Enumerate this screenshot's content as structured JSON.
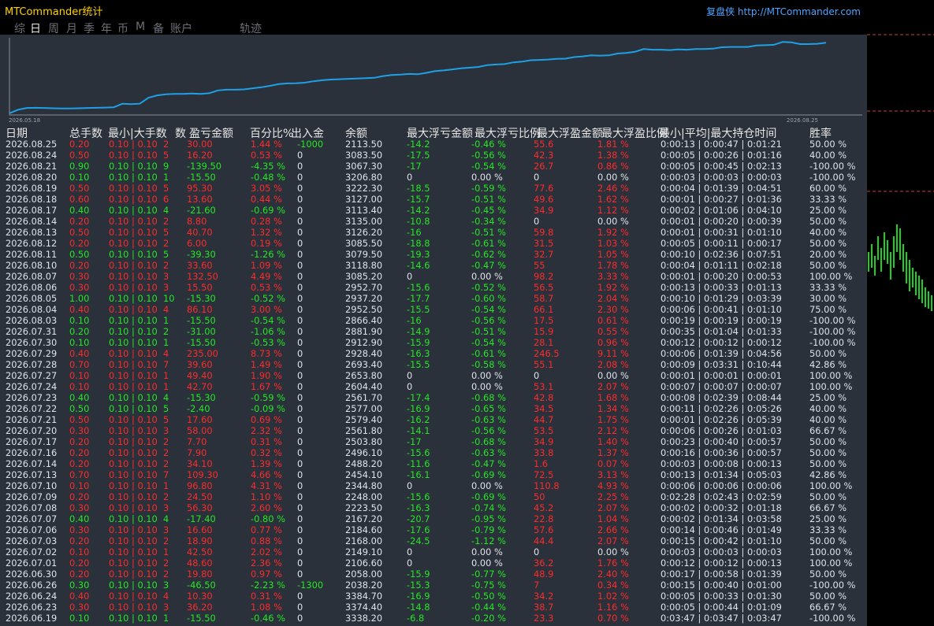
{
  "window": {
    "title": "MTCommander统计",
    "brand": "复盘侠 http://MTCommander.com"
  },
  "tabs": [
    {
      "label": "综"
    },
    {
      "label": "日"
    },
    {
      "label": "周"
    },
    {
      "label": "月"
    },
    {
      "label": "季"
    },
    {
      "label": "年"
    },
    {
      "label": "币"
    },
    {
      "label": "M"
    },
    {
      "label": "备"
    },
    {
      "label": "账户"
    },
    {
      "label": "轨迹"
    }
  ],
  "active_tab": "日",
  "chart": {
    "start_label": "2026.05.18",
    "end_label": "2026.08.25"
  },
  "chart_data": {
    "type": "line",
    "xlabel": "",
    "ylabel": "",
    "x_range": [
      "2026.05.18",
      "2026.08.25"
    ],
    "y_range": [
      1000,
      3200
    ],
    "series": [
      {
        "values": [
          1050,
          1150,
          1200,
          1205,
          1200,
          1190,
          1185,
          1185,
          1190,
          1200,
          1205,
          1210,
          1220,
          1320,
          1310,
          1320,
          1490,
          1560,
          1590,
          1600,
          1600,
          1610,
          1600,
          1620,
          1700,
          1720,
          1720,
          1730,
          1760,
          1790,
          1830,
          1880,
          1900,
          1905,
          1920,
          1960,
          1990,
          2010,
          2020,
          2030,
          2040,
          2050,
          2060,
          2110,
          2140,
          2150,
          2170,
          2160,
          2200,
          2250,
          2270,
          2300,
          2330,
          2350,
          2370,
          2420,
          2440,
          2450,
          2500,
          2520,
          2560,
          2570,
          2580,
          2600,
          2605,
          2650,
          2670,
          2700,
          2690,
          2700,
          2750,
          2770,
          2800,
          2880,
          2860,
          2860,
          2850,
          2870,
          2860,
          2880,
          2880,
          2890,
          2930,
          2940,
          2940,
          2940,
          2980,
          2990,
          3000,
          3080,
          3070,
          3020,
          3020,
          3030,
          3060
        ]
      }
    ],
    "grid": false,
    "legend": "none"
  },
  "columns": [
    "日期",
    "总手数",
    "最小|大手数",
    "数",
    "盈亏金额",
    "百分比%",
    "出入金",
    "余额",
    "最大浮亏金额",
    "最大浮亏比例",
    "最大浮盈金额",
    "最大浮盈比例",
    "最小|平均|最大持仓时间",
    "胜率"
  ],
  "rows": [
    [
      "2026.08.25",
      "0.20",
      "0.10 | 0.10",
      "2",
      "30.00",
      "1.44 %",
      "-1000",
      "2113.50",
      "-14.2",
      "-0.46 %",
      "55.6",
      "1.81 %",
      "0:00:13 | 0:00:47 | 0:01:21",
      "50.00 %"
    ],
    [
      "2026.08.24",
      "0.50",
      "0.10 | 0.10",
      "5",
      "16.20",
      "0.53 %",
      "0",
      "3083.50",
      "-17.5",
      "-0.56 %",
      "42.3",
      "1.38 %",
      "0:00:05 | 0:00:26 | 0:01:16",
      "40.00 %"
    ],
    [
      "2026.08.21",
      "0.90",
      "0.10 | 0.10",
      "9",
      "-139.50",
      "-4.35 %",
      "0",
      "3067.30",
      "-17",
      "-0.54 %",
      "26.7",
      "0.86 %",
      "0:00:05 | 0:00:45 | 0:02:13",
      "-100.00 %"
    ],
    [
      "2026.08.20",
      "0.10",
      "0.10 | 0.10",
      "1",
      "-15.50",
      "-0.48 %",
      "0",
      "3206.80",
      "0",
      "0.00 %",
      "0",
      "0.00 %",
      "0:00:03 | 0:00:03 | 0:00:03",
      "-100.00 %"
    ],
    [
      "2026.08.19",
      "0.50",
      "0.10 | 0.10",
      "5",
      "95.30",
      "3.05 %",
      "0",
      "3222.30",
      "-18.5",
      "-0.59 %",
      "77.6",
      "2.46 %",
      "0:00:04 | 0:01:39 | 0:04:51",
      "60.00 %"
    ],
    [
      "2026.08.18",
      "0.60",
      "0.10 | 0.10",
      "6",
      "13.60",
      "0.44 %",
      "0",
      "3127.00",
      "-15.7",
      "-0.51 %",
      "49.6",
      "1.62 %",
      "0:00:01 | 0:00:27 | 0:01:36",
      "33.33 %"
    ],
    [
      "2026.08.17",
      "0.40",
      "0.10 | 0.10",
      "4",
      "-21.60",
      "-0.69 %",
      "0",
      "3113.40",
      "-14.2",
      "-0.45 %",
      "34.9",
      "1.12 %",
      "0:00:02 | 0:01:06 | 0:04:10",
      "25.00 %"
    ],
    [
      "2026.08.14",
      "0.20",
      "0.10 | 0.10",
      "2",
      "8.80",
      "0.28 %",
      "0",
      "3135.00",
      "-10.8",
      "-0.34 %",
      "0",
      "0.00 %",
      "0:00:01 | 0:00:20 | 0:00:39",
      "50.00 %"
    ],
    [
      "2026.08.13",
      "0.50",
      "0.10 | 0.10",
      "5",
      "40.70",
      "1.32 %",
      "0",
      "3126.20",
      "-16",
      "-0.51 %",
      "59.8",
      "1.92 %",
      "0:00:01 | 0:00:31 | 0:01:10",
      "40.00 %"
    ],
    [
      "2026.08.12",
      "0.20",
      "0.10 | 0.10",
      "2",
      "6.00",
      "0.19 %",
      "0",
      "3085.50",
      "-18.8",
      "-0.61 %",
      "31.5",
      "1.03 %",
      "0:00:05 | 0:00:11 | 0:00:17",
      "50.00 %"
    ],
    [
      "2026.08.11",
      "0.50",
      "0.10 | 0.10",
      "5",
      "-39.30",
      "-1.26 %",
      "0",
      "3079.50",
      "-19.3",
      "-0.62 %",
      "32.7",
      "1.05 %",
      "0:00:10 | 0:02:36 | 0:07:51",
      "20.00 %"
    ],
    [
      "2026.08.10",
      "0.20",
      "0.10 | 0.10",
      "2",
      "33.60",
      "1.09 %",
      "0",
      "3118.80",
      "-14.6",
      "-0.47 %",
      "55",
      "1.78 %",
      "0:00:04 | 0:01:11 | 0:02:18",
      "50.00 %"
    ],
    [
      "2026.08.07",
      "0.30",
      "0.10 | 0.10",
      "3",
      "132.50",
      "4.49 %",
      "0",
      "3085.20",
      "0",
      "0.00 %",
      "98.2",
      "3.33 %",
      "0:00:01 | 0:00:20 | 0:00:53",
      "100.00 %"
    ],
    [
      "2026.08.06",
      "0.30",
      "0.10 | 0.10",
      "3",
      "15.50",
      "0.53 %",
      "0",
      "2952.70",
      "-15.6",
      "-0.52 %",
      "56.5",
      "1.92 %",
      "0:00:13 | 0:00:33 | 0:01:13",
      "33.33 %"
    ],
    [
      "2026.08.05",
      "1.00",
      "0.10 | 0.10",
      "10",
      "-15.30",
      "-0.52 %",
      "0",
      "2937.20",
      "-17.7",
      "-0.60 %",
      "58.7",
      "2.04 %",
      "0:00:10 | 0:01:29 | 0:03:39",
      "30.00 %"
    ],
    [
      "2026.08.04",
      "0.40",
      "0.10 | 0.10",
      "4",
      "86.10",
      "3.00 %",
      "0",
      "2952.50",
      "-15.5",
      "-0.54 %",
      "66.1",
      "2.30 %",
      "0:00:06 | 0:00:41 | 0:01:10",
      "75.00 %"
    ],
    [
      "2026.08.03",
      "0.10",
      "0.10 | 0.10",
      "1",
      "-15.50",
      "-0.54 %",
      "0",
      "2866.40",
      "-16",
      "-0.56 %",
      "17.5",
      "0.61 %",
      "0:00:19 | 0:00:19 | 0:00:19",
      "-100.00 %"
    ],
    [
      "2026.07.31",
      "0.20",
      "0.10 | 0.10",
      "2",
      "-31.00",
      "-1.06 %",
      "0",
      "2881.90",
      "-14.9",
      "-0.51 %",
      "15.9",
      "0.55 %",
      "0:00:35 | 0:01:04 | 0:01:33",
      "-100.00 %"
    ],
    [
      "2026.07.30",
      "0.10",
      "0.10 | 0.10",
      "1",
      "-15.50",
      "-0.53 %",
      "0",
      "2912.90",
      "-15.9",
      "-0.54 %",
      "28.1",
      "0.96 %",
      "0:00:12 | 0:00:12 | 0:00:12",
      "-100.00 %"
    ],
    [
      "2026.07.29",
      "0.40",
      "0.10 | 0.10",
      "4",
      "235.00",
      "8.73 %",
      "0",
      "2928.40",
      "-16.3",
      "-0.61 %",
      "246.5",
      "9.11 %",
      "0:00:06 | 0:01:39 | 0:04:56",
      "50.00 %"
    ],
    [
      "2026.07.28",
      "0.70",
      "0.10 | 0.10",
      "7",
      "39.60",
      "1.49 %",
      "0",
      "2693.40",
      "-15.5",
      "-0.58 %",
      "55.1",
      "2.08 %",
      "0:00:09 | 0:03:31 | 0:10:44",
      "42.86 %"
    ],
    [
      "2026.07.27",
      "0.10",
      "0.10 | 0.10",
      "1",
      "49.40",
      "1.90 %",
      "0",
      "2653.80",
      "0",
      "0.00 %",
      "0",
      "0.00 %",
      "0:00:01 | 0:00:01 | 0:00:01",
      "100.00 %"
    ],
    [
      "2026.07.24",
      "0.10",
      "0.10 | 0.10",
      "1",
      "42.70",
      "1.67 %",
      "0",
      "2604.40",
      "0",
      "0.00 %",
      "53.1",
      "2.07 %",
      "0:00:07 | 0:00:07 | 0:00:07",
      "100.00 %"
    ],
    [
      "2026.07.23",
      "0.40",
      "0.10 | 0.10",
      "4",
      "-15.30",
      "-0.59 %",
      "0",
      "2561.70",
      "-17.4",
      "-0.68 %",
      "42.8",
      "1.68 %",
      "0:00:08 | 0:02:39 | 0:08:44",
      "25.00 %"
    ],
    [
      "2026.07.22",
      "0.50",
      "0.10 | 0.10",
      "5",
      "-2.40",
      "-0.09 %",
      "0",
      "2577.00",
      "-16.9",
      "-0.65 %",
      "34.5",
      "1.34 %",
      "0:00:11 | 0:02:26 | 0:05:26",
      "40.00 %"
    ],
    [
      "2026.07.21",
      "0.50",
      "0.10 | 0.10",
      "5",
      "17.60",
      "0.69 %",
      "0",
      "2579.40",
      "-16.2",
      "-0.63 %",
      "44.7",
      "1.75 %",
      "0:00:01 | 0:02:26 | 0:05:39",
      "40.00 %"
    ],
    [
      "2026.07.20",
      "0.30",
      "0.10 | 0.10",
      "3",
      "58.00",
      "2.32 %",
      "0",
      "2561.80",
      "-14.1",
      "-0.56 %",
      "53.5",
      "2.12 %",
      "0:00:06 | 0:00:26 | 0:01:03",
      "66.67 %"
    ],
    [
      "2026.07.17",
      "0.20",
      "0.10 | 0.10",
      "2",
      "7.70",
      "0.31 %",
      "0",
      "2503.80",
      "-17",
      "-0.68 %",
      "34.9",
      "1.40 %",
      "0:00:23 | 0:00:40 | 0:00:57",
      "50.00 %"
    ],
    [
      "2026.07.16",
      "0.20",
      "0.10 | 0.10",
      "2",
      "7.90",
      "0.32 %",
      "0",
      "2496.10",
      "-15.6",
      "-0.63 %",
      "33.8",
      "1.37 %",
      "0:00:16 | 0:00:36 | 0:00:57",
      "50.00 %"
    ],
    [
      "2026.07.14",
      "0.20",
      "0.10 | 0.10",
      "2",
      "34.10",
      "1.39 %",
      "0",
      "2488.20",
      "-11.6",
      "-0.47 %",
      "1.6",
      "0.07 %",
      "0:00:03 | 0:00:08 | 0:00:13",
      "50.00 %"
    ],
    [
      "2026.07.13",
      "0.70",
      "0.10 | 0.10",
      "7",
      "109.30",
      "4.66 %",
      "0",
      "2454.10",
      "-16.1",
      "-0.69 %",
      "72.5",
      "3.13 %",
      "0:00:13 | 0:01:34 | 0:05:03",
      "42.86 %"
    ],
    [
      "2026.07.10",
      "0.10",
      "0.10 | 0.10",
      "1",
      "96.80",
      "4.31 %",
      "0",
      "2344.80",
      "0",
      "0.00 %",
      "110.8",
      "4.93 %",
      "0:00:06 | 0:00:06 | 0:00:06",
      "100.00 %"
    ],
    [
      "2026.07.09",
      "0.20",
      "0.10 | 0.10",
      "2",
      "24.50",
      "1.10 %",
      "0",
      "2248.00",
      "-15.6",
      "-0.69 %",
      "50",
      "2.25 %",
      "0:02:28 | 0:02:43 | 0:02:59",
      "50.00 %"
    ],
    [
      "2026.07.08",
      "0.30",
      "0.10 | 0.10",
      "3",
      "56.30",
      "2.60 %",
      "0",
      "2223.50",
      "-16.3",
      "-0.74 %",
      "45.2",
      "2.07 %",
      "0:00:02 | 0:00:32 | 0:01:18",
      "66.67 %"
    ],
    [
      "2026.07.07",
      "0.40",
      "0.10 | 0.10",
      "4",
      "-17.40",
      "-0.80 %",
      "0",
      "2167.20",
      "-20.7",
      "-0.95 %",
      "22.8",
      "1.04 %",
      "0:00:02 | 0:01:34 | 0:03:58",
      "25.00 %"
    ],
    [
      "2026.07.06",
      "0.30",
      "0.10 | 0.10",
      "3",
      "16.60",
      "0.77 %",
      "0",
      "2184.60",
      "-17.6",
      "-0.79 %",
      "57.6",
      "2.66 %",
      "0:00:14 | 0:00:46 | 0:01:49",
      "33.33 %"
    ],
    [
      "2026.07.03",
      "0.20",
      "0.10 | 0.10",
      "2",
      "18.90",
      "0.88 %",
      "0",
      "2168.00",
      "-24.5",
      "-1.12 %",
      "44.4",
      "2.07 %",
      "0:00:15 | 0:00:42 | 0:01:10",
      "50.00 %"
    ],
    [
      "2026.07.02",
      "0.10",
      "0.10 | 0.10",
      "1",
      "42.50",
      "2.02 %",
      "0",
      "2149.10",
      "0",
      "0.00 %",
      "0",
      "0.00 %",
      "0:00:03 | 0:00:03 | 0:00:03",
      "100.00 %"
    ],
    [
      "2026.07.01",
      "0.20",
      "0.10 | 0.10",
      "2",
      "48.60",
      "2.36 %",
      "0",
      "2106.60",
      "0",
      "0.00 %",
      "36.2",
      "1.76 %",
      "0:00:12 | 0:00:12 | 0:00:13",
      "100.00 %"
    ],
    [
      "2026.06.30",
      "0.20",
      "0.10 | 0.10",
      "2",
      "19.80",
      "0.97 %",
      "0",
      "2058.00",
      "-15.9",
      "-0.77 %",
      "48.9",
      "2.40 %",
      "0:00:17 | 0:00:58 | 0:01:39",
      "50.00 %"
    ],
    [
      "2026.06.26",
      "0.30",
      "0.10 | 0.10",
      "3",
      "-46.50",
      "-2.23 %",
      "-1300",
      "2038.20",
      "-15.3",
      "-0.75 %",
      "7",
      "0.34 %",
      "0:00:15 | 0:00:40 | 0:01:00",
      "-100.00 %"
    ],
    [
      "2026.06.24",
      "0.40",
      "0.10 | 0.10",
      "4",
      "10.30",
      "0.31 %",
      "0",
      "3384.70",
      "-16.9",
      "-0.50 %",
      "34.2",
      "1.02 %",
      "0:00:05 | 0:00:33 | 0:01:30",
      "50.00 %"
    ],
    [
      "2026.06.23",
      "0.30",
      "0.10 | 0.10",
      "3",
      "36.20",
      "1.08 %",
      "0",
      "3374.40",
      "-14.8",
      "-0.44 %",
      "38.7",
      "1.16 %",
      "0:00:05 | 0:00:44 | 0:01:09",
      "66.67 %"
    ],
    [
      "2026.06.19",
      "0.10",
      "0.10 | 0.10",
      "1",
      "-15.50",
      "-0.46 %",
      "0",
      "3338.20",
      "-6.8",
      "-0.20 %",
      "23.3",
      "0.70 %",
      "0:03:47 | 0:03:47 | 0:03:47",
      "-100.00 %"
    ]
  ],
  "colors": {
    "panel_bg": "#2b313b",
    "equity_line": "#1ea0e6",
    "profit": "#ff2a2a",
    "loss": "#22e822",
    "text": "#dfe3e8",
    "title": "#ffd200",
    "brand": "#4da3ff",
    "side_candles": "#19d219",
    "side_levels": "#c84632"
  }
}
